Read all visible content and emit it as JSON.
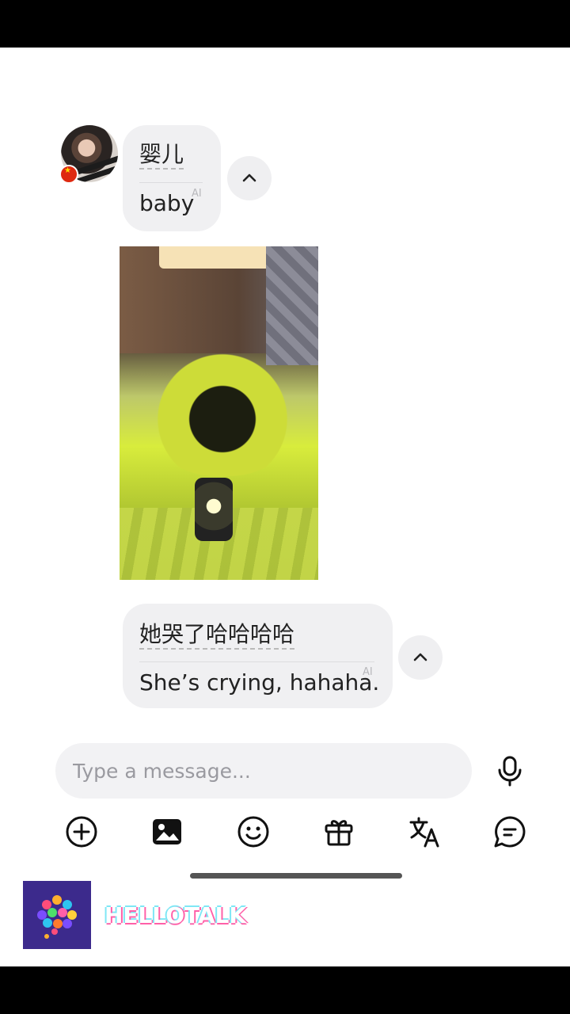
{
  "messages": [
    {
      "original": "婴儿",
      "translation": "baby",
      "ai_tag": "AI"
    },
    {
      "original": "她哭了哈哈哈哈",
      "translation": "She’s crying, hahaha.",
      "ai_tag": "AI"
    }
  ],
  "input": {
    "placeholder": "Type a message..."
  },
  "toolbar": [
    "plus-circle-icon",
    "image-icon",
    "emoji-icon",
    "gift-icon",
    "translate-icon",
    "chat-bubble-icon"
  ],
  "brand": {
    "name": "HELLOTALK"
  }
}
